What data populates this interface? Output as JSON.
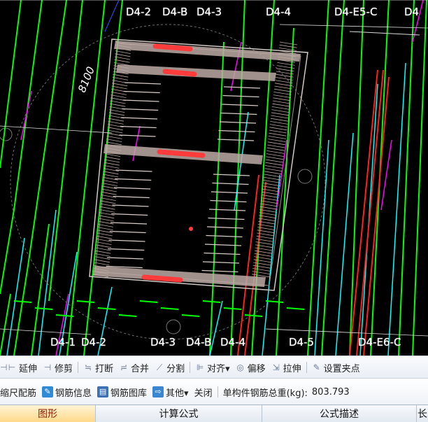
{
  "axis_labels": {
    "top": [
      "D4-2",
      "D4-B",
      "D4-3",
      "D4-4",
      "D4-E5-C",
      "D4"
    ],
    "bottom": [
      "D4-1",
      "D4-2",
      "D4-3",
      "D4-B",
      "D4-4",
      "D4-5",
      "D4-E6-C"
    ]
  },
  "dimension_label": "8100",
  "toolbar1": {
    "items": [
      {
        "icon": "extend-icon",
        "label": "延伸"
      },
      {
        "icon": "trim-icon",
        "label": "修剪"
      },
      {
        "icon": "break-icon",
        "label": "打断"
      },
      {
        "icon": "merge-icon",
        "label": "合并"
      },
      {
        "icon": "split-icon",
        "label": "分割"
      },
      {
        "icon": "align-icon",
        "label": "对齐▾"
      },
      {
        "icon": "offset-icon",
        "label": "偏移"
      },
      {
        "icon": "stretch-icon",
        "label": "拉伸"
      },
      {
        "icon": "set-point-icon",
        "label": "设置夹点"
      }
    ]
  },
  "toolbar2": {
    "items": [
      {
        "icon": "",
        "label": "缩尺配筋"
      },
      {
        "icon": "rebar-info-icon",
        "label": "钢筋信息"
      },
      {
        "icon": "rebar-library-icon",
        "label": "钢筋图库"
      },
      {
        "icon": "other-icon",
        "label": "其他▾"
      },
      {
        "icon": "",
        "label": "关闭"
      }
    ],
    "total_weight_label": "单构件钢筋总重(kg):",
    "total_weight_value": "803.793"
  },
  "table_headers": [
    "图形",
    "计算公式",
    "公式描述",
    "长"
  ],
  "colors": {
    "background": "#000000",
    "green": "#00ff00",
    "cyan": "#00ffff",
    "magenta": "#ff00ff",
    "red_highlight": "#ff3b3b",
    "rebar_gray": "#c8b8b0"
  }
}
